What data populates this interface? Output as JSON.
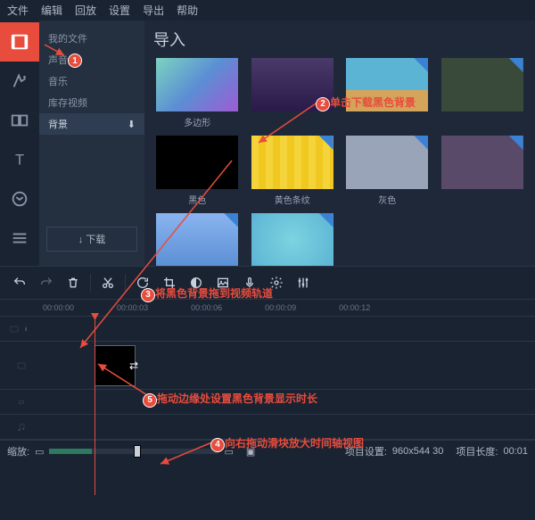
{
  "menu": {
    "file": "文件",
    "edit": "编辑",
    "playback": "回放",
    "settings": "设置",
    "export": "导出",
    "help": "帮助"
  },
  "categories": {
    "myfiles": "我的文件",
    "audio": "声音",
    "music": "音乐",
    "stock": "库存视频",
    "background": "背景",
    "download": "↓ 下载"
  },
  "content": {
    "title": "导入"
  },
  "thumbs": {
    "polygon": "多边形",
    "black": "黑色",
    "yellowstripe": "黄色条纹",
    "gray": "灰色"
  },
  "bottom": {
    "zoom": "缩放:",
    "projectset": "项目设置:",
    "resolution": "960x544 30",
    "projectlen": "项目长度:",
    "duration": "00:01"
  },
  "ruler": [
    "00:00:00",
    "00:00:03",
    "00:00:06",
    "00:00:09",
    "00:00:12"
  ],
  "annot": {
    "a2": "单击下载黑色背景",
    "a3": "将黑色背景拖到视频轨道",
    "a4": "向右拖动滑块放大时间轴视图",
    "a5": "拖动边缘处设置黑色背景显示时长"
  }
}
